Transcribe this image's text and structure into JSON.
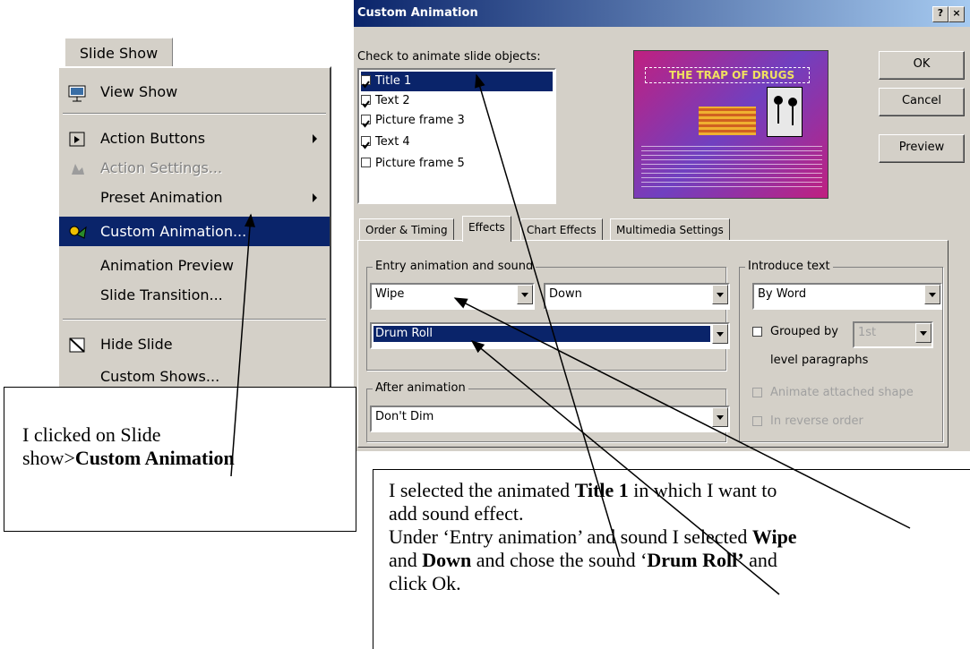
{
  "menu": {
    "title": "Slide Show",
    "items": [
      {
        "label": "View Show",
        "icon": "projector-icon",
        "disabled": false,
        "submenu": false
      },
      {
        "label": "Action Buttons",
        "icon": "action-buttons-icon",
        "disabled": false,
        "submenu": true
      },
      {
        "label": "Action Settings...",
        "icon": "action-settings-icon",
        "disabled": true,
        "submenu": false
      },
      {
        "label": "Preset Animation",
        "icon": "",
        "disabled": false,
        "submenu": true
      },
      {
        "label": "Custom Animation...",
        "icon": "custom-animation-icon",
        "disabled": false,
        "submenu": false,
        "selected": true
      },
      {
        "label": "Animation Preview",
        "icon": "",
        "disabled": false,
        "submenu": false
      },
      {
        "label": "Slide Transition...",
        "icon": "",
        "disabled": false,
        "submenu": false
      },
      {
        "label": "Hide Slide",
        "icon": "hide-slide-icon",
        "disabled": false,
        "submenu": false
      },
      {
        "label": "Custom Shows...",
        "icon": "",
        "disabled": false,
        "submenu": false
      }
    ]
  },
  "dialog": {
    "title": "Custom Animation",
    "help": "?",
    "close": "×",
    "check_label": "Check to animate slide objects:",
    "objects": [
      {
        "label": "Title 1",
        "checked": true,
        "selected": true
      },
      {
        "label": "Text 2",
        "checked": true
      },
      {
        "label": "Picture frame 3",
        "checked": true
      },
      {
        "label": "Text 4",
        "checked": true
      },
      {
        "label": "Picture frame 5",
        "checked": false
      }
    ],
    "preview_title": "THE TRAP OF DRUGS",
    "buttons": {
      "ok": "OK",
      "cancel": "Cancel",
      "preview": "Preview"
    },
    "tabs": [
      "Order & Timing",
      "Effects",
      "Chart Effects",
      "Multimedia Settings"
    ],
    "active_tab": "Effects",
    "entry_group": "Entry animation and sound",
    "effect": "Wipe",
    "direction": "Down",
    "sound": "Drum Roll",
    "after_group": "After animation",
    "after": "Don't Dim",
    "introduce_group": "Introduce text",
    "introduce": "By Word",
    "grouped_by": "Grouped by",
    "grouped_value": "1st",
    "level_paragraphs": "level paragraphs",
    "animate_attached": "Animate attached shape",
    "reverse_order": "In reverse order"
  },
  "callout_left": {
    "line1": "I clicked on Slide",
    "line2_prefix": "show>",
    "line2_bold": "Custom Animation"
  },
  "callout_right": {
    "p1_a": "I selected the animated ",
    "p1_b": "Title 1",
    "p1_c": " in which I want to",
    "p2": "add sound effect.",
    "p3_a": "Under ‘Entry animation’ and sound I selected ",
    "p3_b": "Wipe",
    "p4_a": "and ",
    "p4_b": "Down",
    "p4_c": " and chose the sound ‘",
    "p4_d": "Drum Roll’",
    "p4_e": " and",
    "p5": "click Ok."
  }
}
